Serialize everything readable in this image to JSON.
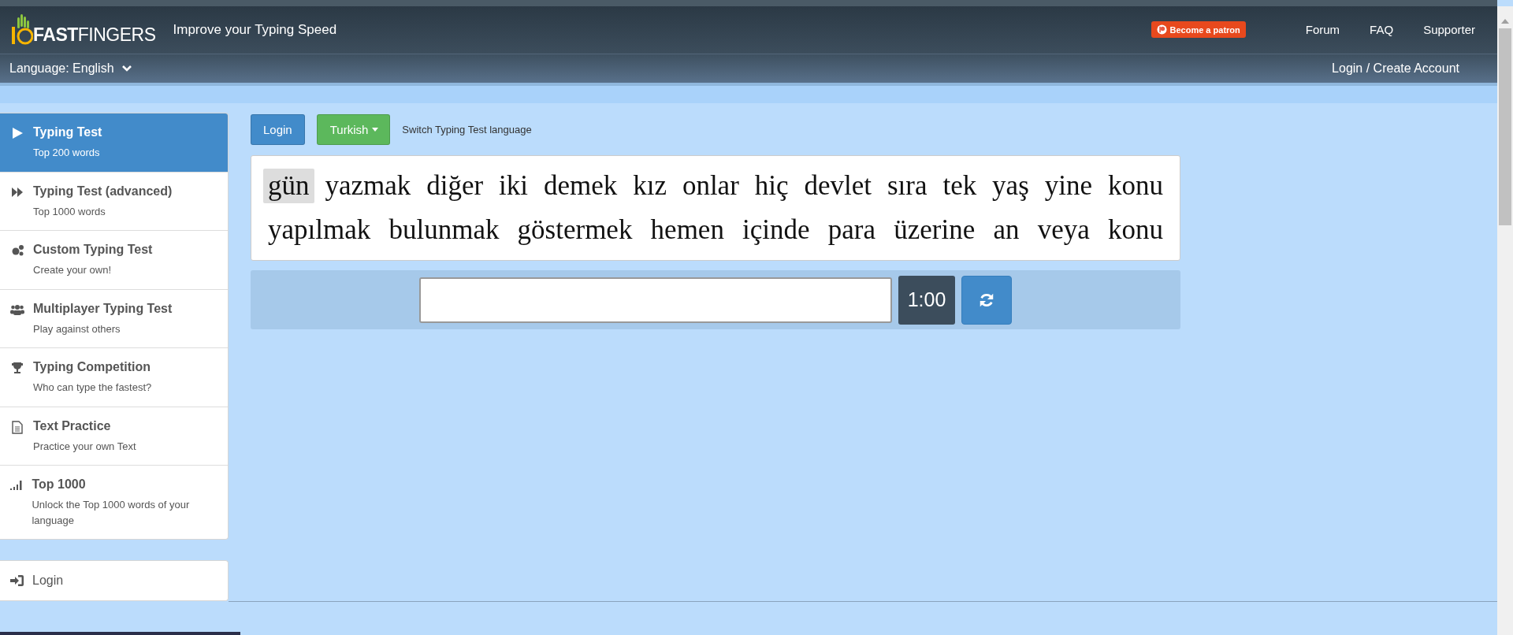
{
  "header": {
    "logo": {
      "bold": "FAST",
      "light": "FINGERS"
    },
    "tagline": "Improve your Typing Speed",
    "patron_button": "Become a patron",
    "nav": [
      "Forum",
      "FAQ",
      "Supporter"
    ]
  },
  "subbar": {
    "language": "Language: English",
    "account": "Login / Create Account"
  },
  "sidebar": {
    "items": [
      {
        "title": "Typing Test",
        "subtitle": "Top 200 words",
        "selected": true
      },
      {
        "title": "Typing Test (advanced)",
        "subtitle": "Top 1000 words",
        "selected": false
      },
      {
        "title": "Custom Typing Test",
        "subtitle": "Create your own!",
        "selected": false
      },
      {
        "title": "Multiplayer Typing Test",
        "subtitle": "Play against others",
        "selected": false
      },
      {
        "title": "Typing Competition",
        "subtitle": "Who can type the fastest?",
        "selected": false
      },
      {
        "title": "Text Practice",
        "subtitle": "Practice your own Text",
        "selected": false
      },
      {
        "title": "Top 1000",
        "subtitle": "Unlock the Top 1000 words of your language",
        "selected": false
      }
    ],
    "login": "Login"
  },
  "toolbar": {
    "login_button": "Login",
    "language_button": "Turkish",
    "hint": "Switch Typing Test language"
  },
  "words": {
    "lines": [
      [
        {
          "text": "gün",
          "selected": true
        },
        {
          "text": "yazmak",
          "selected": false
        },
        {
          "text": "diğer",
          "selected": false
        },
        {
          "text": "iki",
          "selected": false
        },
        {
          "text": "demek",
          "selected": false
        },
        {
          "text": "kız",
          "selected": false
        },
        {
          "text": "onlar",
          "selected": false
        },
        {
          "text": "hiç",
          "selected": false
        },
        {
          "text": "devlet",
          "selected": false
        },
        {
          "text": "sıra",
          "selected": false
        },
        {
          "text": "tek",
          "selected": false
        },
        {
          "text": "yaş",
          "selected": false
        },
        {
          "text": "yine",
          "selected": false
        },
        {
          "text": "konu",
          "selected": false
        }
      ],
      [
        {
          "text": "yapılmak",
          "selected": false
        },
        {
          "text": "bulunmak",
          "selected": false
        },
        {
          "text": "göstermek",
          "selected": false
        },
        {
          "text": "hemen",
          "selected": false
        },
        {
          "text": "içinde",
          "selected": false
        },
        {
          "text": "para",
          "selected": false
        },
        {
          "text": "üzerine",
          "selected": false
        },
        {
          "text": "an",
          "selected": false
        },
        {
          "text": "veya",
          "selected": false
        },
        {
          "text": "konu",
          "selected": false
        }
      ]
    ]
  },
  "input_row": {
    "timer": "1:00"
  }
}
